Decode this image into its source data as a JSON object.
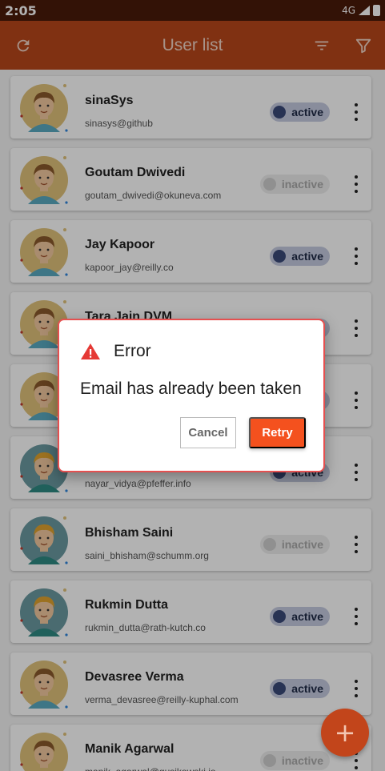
{
  "status_bar": {
    "time": "2:05",
    "network": "4G"
  },
  "app_bar": {
    "title": "User list",
    "icons": [
      "refresh-icon",
      "sort-icon",
      "filter-icon"
    ]
  },
  "users": [
    {
      "name": "sinaSys",
      "email": "sinasys@github",
      "status": "active",
      "avatar": "light"
    },
    {
      "name": "Goutam Dwivedi",
      "email": "goutam_dwivedi@okuneva.com",
      "status": "inactive",
      "avatar": "light"
    },
    {
      "name": "Jay Kapoor",
      "email": "kapoor_jay@reilly.co",
      "status": "active",
      "avatar": "light"
    },
    {
      "name": "Tara Jain DVM",
      "email": "",
      "status": "active",
      "avatar": "light"
    },
    {
      "name": "",
      "email": "",
      "status": "active",
      "avatar": "light"
    },
    {
      "name": "",
      "email": "nayar_vidya@pfeffer.info",
      "status": "active",
      "avatar": "teal"
    },
    {
      "name": "Bhisham Saini",
      "email": "saini_bhisham@schumm.org",
      "status": "inactive",
      "avatar": "teal"
    },
    {
      "name": "Rukmin Dutta",
      "email": "rukmin_dutta@rath-kutch.co",
      "status": "active",
      "avatar": "teal"
    },
    {
      "name": "Devasree Verma",
      "email": "verma_devasree@reilly-kuphal.com",
      "status": "active",
      "avatar": "light"
    },
    {
      "name": "Manik Agarwal",
      "email": "manik_agarwal@gusikowski.io",
      "status": "inactive",
      "avatar": "light"
    }
  ],
  "dialog": {
    "title": "Error",
    "message": "Email has already been taken",
    "cancel_label": "Cancel",
    "retry_label": "Retry"
  },
  "fab": {
    "label": "+"
  },
  "colors": {
    "app_bar": "#b8471a",
    "status_bar": "#4a1a09",
    "active_badge": "#c5cbe0",
    "active_dot": "#3a4a79",
    "retry_button": "#f4511e",
    "dialog_border": "#e55050"
  }
}
